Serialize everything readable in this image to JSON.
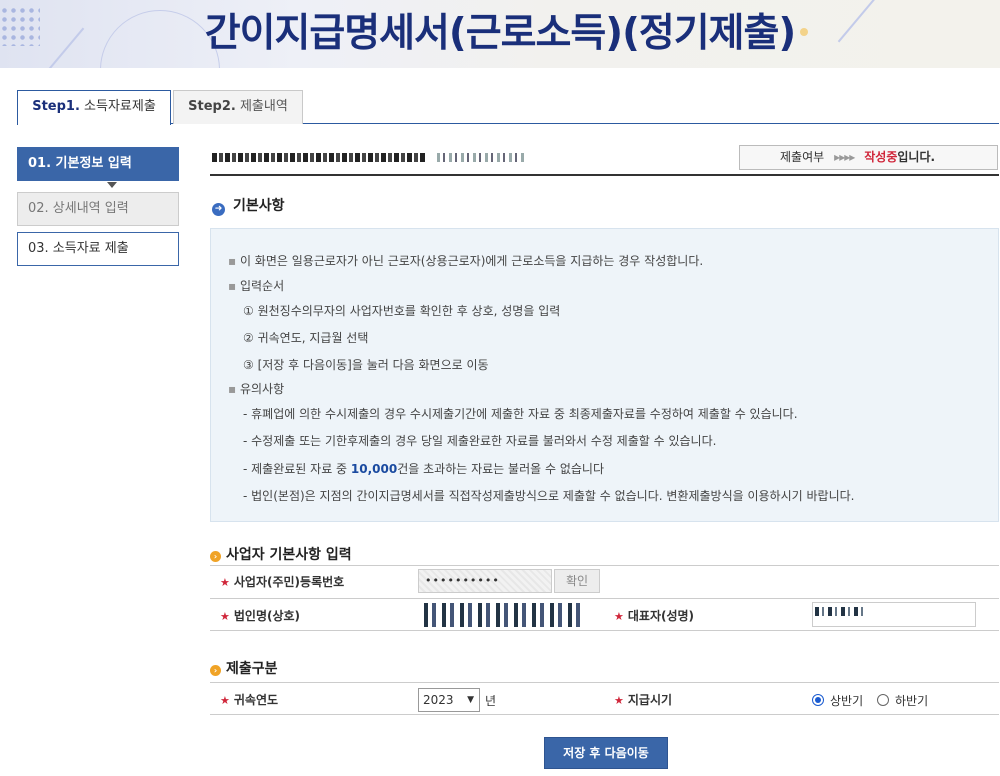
{
  "banner": {
    "title": "간이지급명세서(근로소득)(정기제출)"
  },
  "tabs": [
    {
      "label_main": "Step1.",
      "label_sub": " 소득자료제출"
    },
    {
      "label_main": "Step2.",
      "label_sub": " 제출내역"
    }
  ],
  "sidebar": {
    "items": [
      {
        "label": "01. 기본정보 입력"
      },
      {
        "label": "02. 상세내역 입력"
      },
      {
        "label": "03. 소득자료 제출"
      }
    ]
  },
  "status": {
    "label": "제출여부",
    "arrows": "▸▸▸▸",
    "value": "작성중",
    "suffix": "입니다."
  },
  "basic": {
    "title": "기본사항",
    "lines": [
      "이 화면은 일용근로자가 아닌 근로자(상용근로자)에게 근로소득을 지급하는 경우 작성합니다.",
      "입력순서",
      "①  원천징수의무자의 사업자번호를 확인한 후 상호, 성명을 입력",
      "②  귀속연도, 지급월 선택",
      "③  [저장 후 다음이동]을 눌러 다음 화면으로 이동",
      "유의사항",
      "- 휴폐업에 의한 수시제출의 경우 수시제출기간에 제출한 자료 중 최종제출자료를 수정하여 제출할 수 있습니다.",
      "- 수정제출 또는 기한후제출의 경우 당일 제출완료한 자료를 불러와서 수정 제출할 수 있습니다.",
      "- 제출완료된 자료 중 ",
      "- 법인(본점)은 지점의 간이지급명세서를 직접작성제출방식으로 제출할 수 없습니다. 변환제출방식을 이용하시기 바랍니다."
    ],
    "limit_number": "10,000",
    "limit_suffix": "건을 초과하는 자료는 불러올 수 없습니다"
  },
  "biz": {
    "title": "사업자 기본사항 입력",
    "reg_label": "사업자(주민)등록번호",
    "reg_value": "••••••••••",
    "confirm_label": "확인",
    "corp_label": "법인명(상호)",
    "rep_label": "대표자(성명)"
  },
  "submit": {
    "title": "제출구분",
    "year_label": "귀속연도",
    "year_value": "2023",
    "year_unit": "년",
    "period_label": "지급시기",
    "option_first": "상반기",
    "option_second": "하반기"
  },
  "save_label": "저장 후 다음이동",
  "colors": {
    "accent": "#3a66a8",
    "status_red": "#d0263a",
    "title_navy": "#1a2f7a"
  }
}
